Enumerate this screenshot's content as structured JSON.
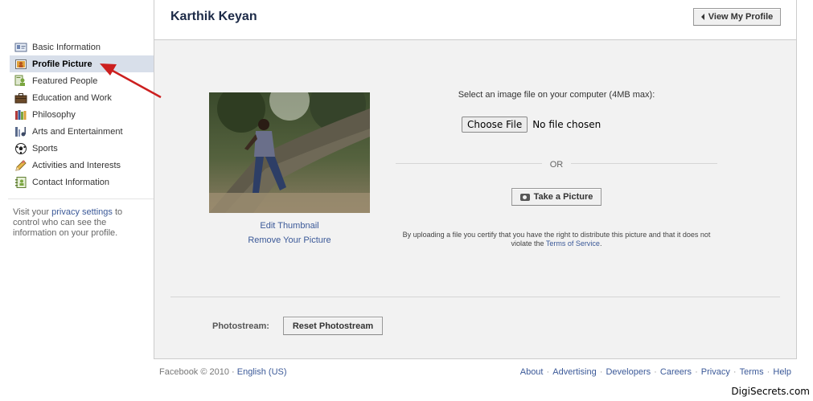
{
  "sidebar": {
    "items": [
      {
        "label": "Basic Information",
        "icon": "id-card-icon"
      },
      {
        "label": "Profile Picture",
        "icon": "picture-icon",
        "selected": true
      },
      {
        "label": "Featured People",
        "icon": "people-icon"
      },
      {
        "label": "Education and Work",
        "icon": "briefcase-icon"
      },
      {
        "label": "Philosophy",
        "icon": "books-icon"
      },
      {
        "label": "Arts and Entertainment",
        "icon": "music-icon"
      },
      {
        "label": "Sports",
        "icon": "soccer-ball-icon"
      },
      {
        "label": "Activities and Interests",
        "icon": "pencil-icon"
      },
      {
        "label": "Contact Information",
        "icon": "contact-icon"
      }
    ],
    "note_prefix": "Visit your",
    "note_link": "privacy settings",
    "note_suffix": "to control who can see the information on your profile."
  },
  "header": {
    "title": "Karthik Keyan",
    "view_profile_label": "View My Profile"
  },
  "main": {
    "edit_thumbnail": "Edit Thumbnail",
    "remove_picture": "Remove Your Picture",
    "upload_label": "Select an image file on your computer (4MB max):",
    "choose_file_label": "Choose File",
    "no_file_label": "No file chosen",
    "or_label": "OR",
    "take_picture_label": "Take a Picture",
    "disclaimer_text": "By uploading a file you certify that you have the right to distribute this picture and that it does not violate the",
    "disclaimer_link": "Terms of Service",
    "photostream_label": "Photostream:",
    "reset_photostream_label": "Reset Photostream"
  },
  "footer": {
    "copyright": "Facebook © 2010 ·",
    "language": "English (US)",
    "links": [
      "About",
      "Advertising",
      "Developers",
      "Careers",
      "Privacy",
      "Terms",
      "Help"
    ]
  },
  "watermark": "DigiSecrets.com",
  "colors": {
    "link": "#3b5998",
    "selected_bg": "#d8dfea",
    "panel_bg": "#f2f2f2",
    "annotation_arrow": "#cc1f1f"
  }
}
